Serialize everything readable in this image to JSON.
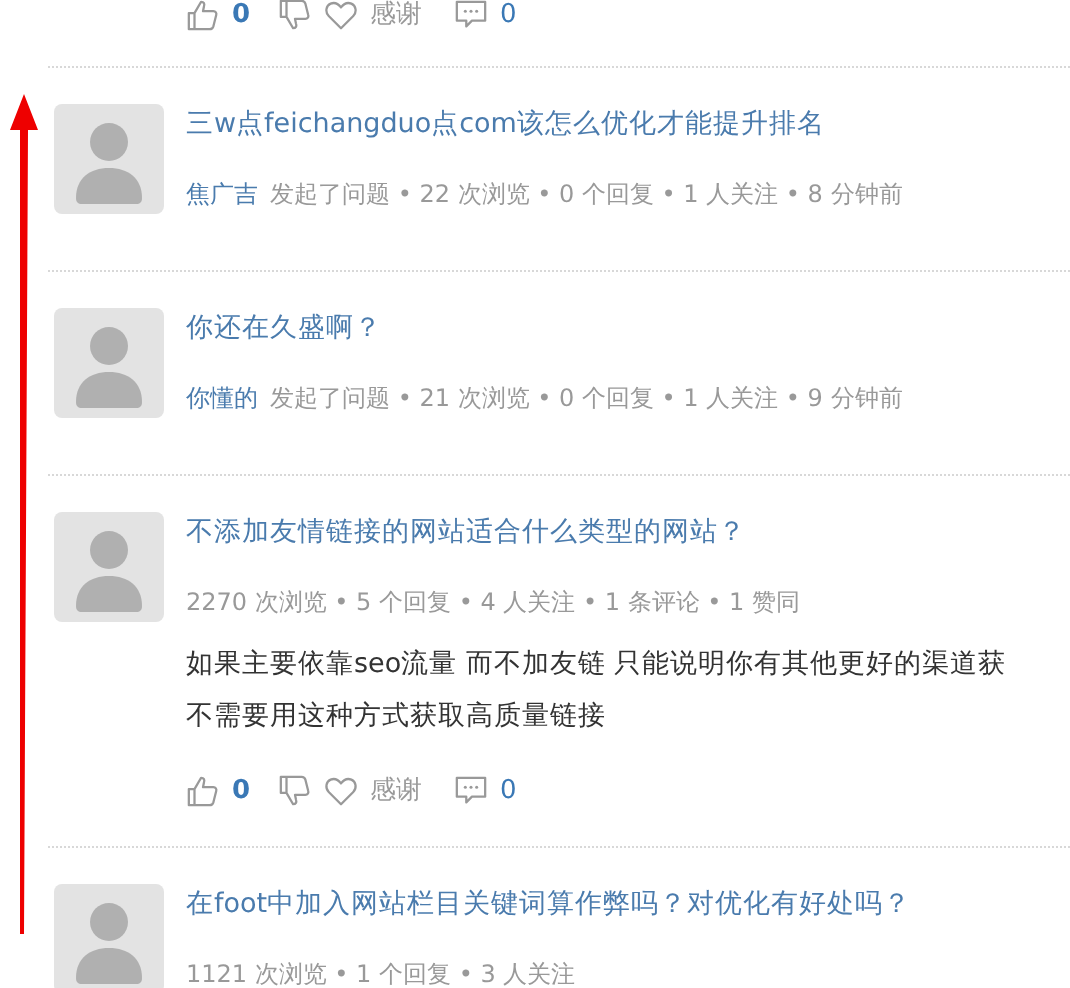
{
  "feed": [
    {
      "kind": "actions",
      "votes": "0",
      "thanks": "感谢",
      "comments": "0"
    },
    {
      "kind": "question",
      "title": "三w点feichangduo点com该怎么优化才能提升排名",
      "author": "焦广吉",
      "meta": "发起了问题 • 22 次浏览 • 0 个回复 • 1 人关注 • 8 分钟前"
    },
    {
      "kind": "question",
      "title": "你还在久盛啊？",
      "author": "你懂的",
      "meta": "发起了问题 • 21 次浏览 • 0 个回复 • 1 人关注 • 9 分钟前"
    },
    {
      "kind": "answer",
      "title": "不添加友情链接的网站适合什么类型的网站？",
      "meta": "2270 次浏览 • 5 个回复 • 4 人关注 • 1 条评论 • 1 赞同",
      "body": [
        "如果主要依靠seo流量 而不加友链 只能说明你有其他更好的渠道获",
        "不需要用这种方式获取高质量链接"
      ],
      "votes": "0",
      "thanks": "感谢",
      "comments": "0"
    },
    {
      "kind": "answer",
      "title": "在foot中加入网站栏目关键词算作弊吗？对优化有好处吗？",
      "meta": "1121 次浏览 • 1 个回复 • 3 人关注"
    }
  ]
}
